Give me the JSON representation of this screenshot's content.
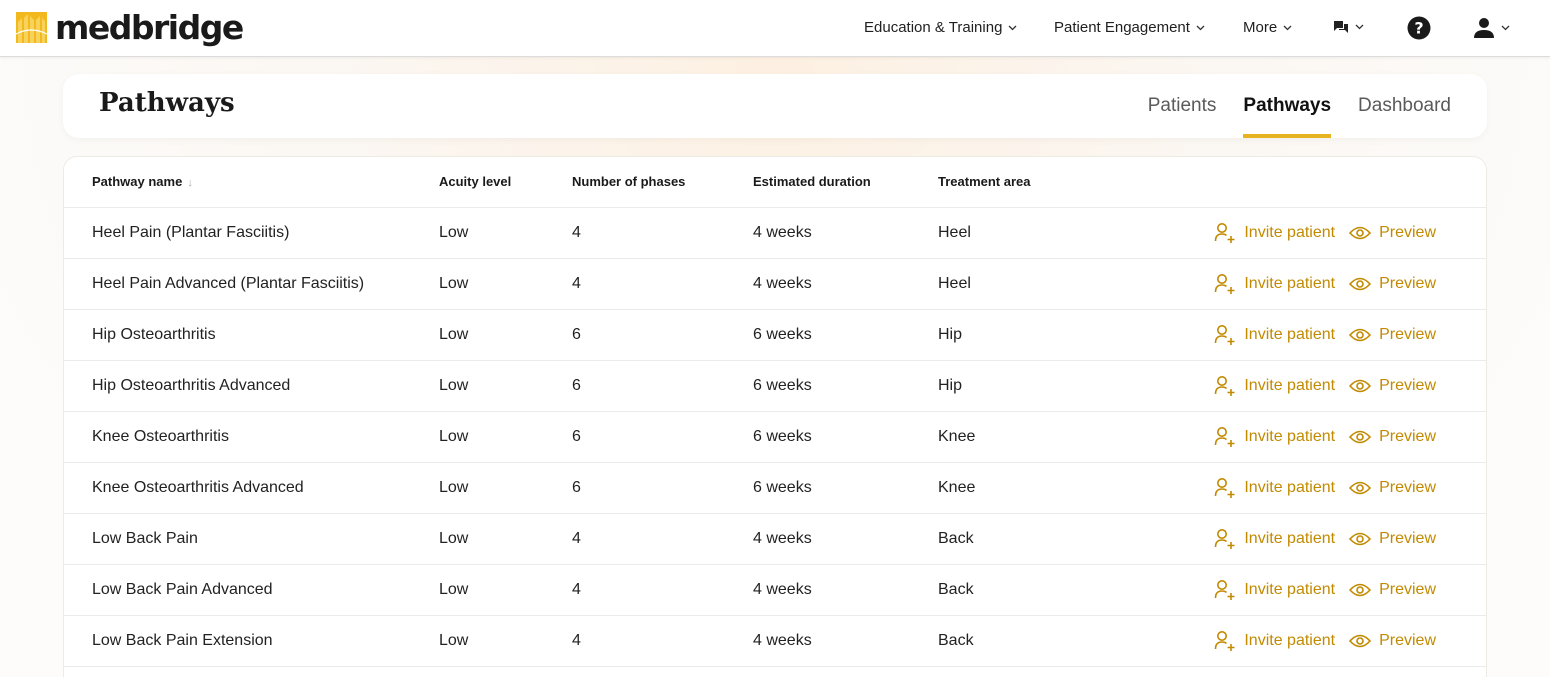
{
  "brand": {
    "name": "medbridge",
    "accent": "#e8b321",
    "link_color": "#c28a00"
  },
  "nav": {
    "education": "Education & Training",
    "patient_engagement": "Patient Engagement",
    "more": "More",
    "messages_icon": "chat-bubbles-icon",
    "help_icon": "question-circle-icon",
    "user_icon": "user-icon"
  },
  "header": {
    "title": "Pathways",
    "tabs": [
      {
        "label": "Patients",
        "active": false
      },
      {
        "label": "Pathways",
        "active": true
      },
      {
        "label": "Dashboard",
        "active": false
      }
    ]
  },
  "table": {
    "columns": {
      "name": "Pathway name",
      "acuity": "Acuity level",
      "phases": "Number of phases",
      "duration": "Estimated duration",
      "area": "Treatment area"
    },
    "sort": {
      "column": "name",
      "direction": "desc-arrow"
    },
    "action_invite": "Invite patient",
    "action_preview": "Preview",
    "rows": [
      {
        "name": "Heel Pain (Plantar Fasciitis)",
        "acuity": "Low",
        "phases": "4",
        "duration": "4 weeks",
        "area": "Heel"
      },
      {
        "name": "Heel Pain Advanced (Plantar Fasciitis)",
        "acuity": "Low",
        "phases": "4",
        "duration": "4 weeks",
        "area": "Heel"
      },
      {
        "name": "Hip Osteoarthritis",
        "acuity": "Low",
        "phases": "6",
        "duration": "6 weeks",
        "area": "Hip"
      },
      {
        "name": "Hip Osteoarthritis Advanced",
        "acuity": "Low",
        "phases": "6",
        "duration": "6 weeks",
        "area": "Hip"
      },
      {
        "name": "Knee Osteoarthritis",
        "acuity": "Low",
        "phases": "6",
        "duration": "6 weeks",
        "area": "Knee"
      },
      {
        "name": "Knee Osteoarthritis Advanced",
        "acuity": "Low",
        "phases": "6",
        "duration": "6 weeks",
        "area": "Knee"
      },
      {
        "name": "Low Back Pain",
        "acuity": "Low",
        "phases": "4",
        "duration": "4 weeks",
        "area": "Back"
      },
      {
        "name": "Low Back Pain Advanced",
        "acuity": "Low",
        "phases": "4",
        "duration": "4 weeks",
        "area": "Back"
      },
      {
        "name": "Low Back Pain Extension",
        "acuity": "Low",
        "phases": "4",
        "duration": "4 weeks",
        "area": "Back"
      }
    ]
  }
}
